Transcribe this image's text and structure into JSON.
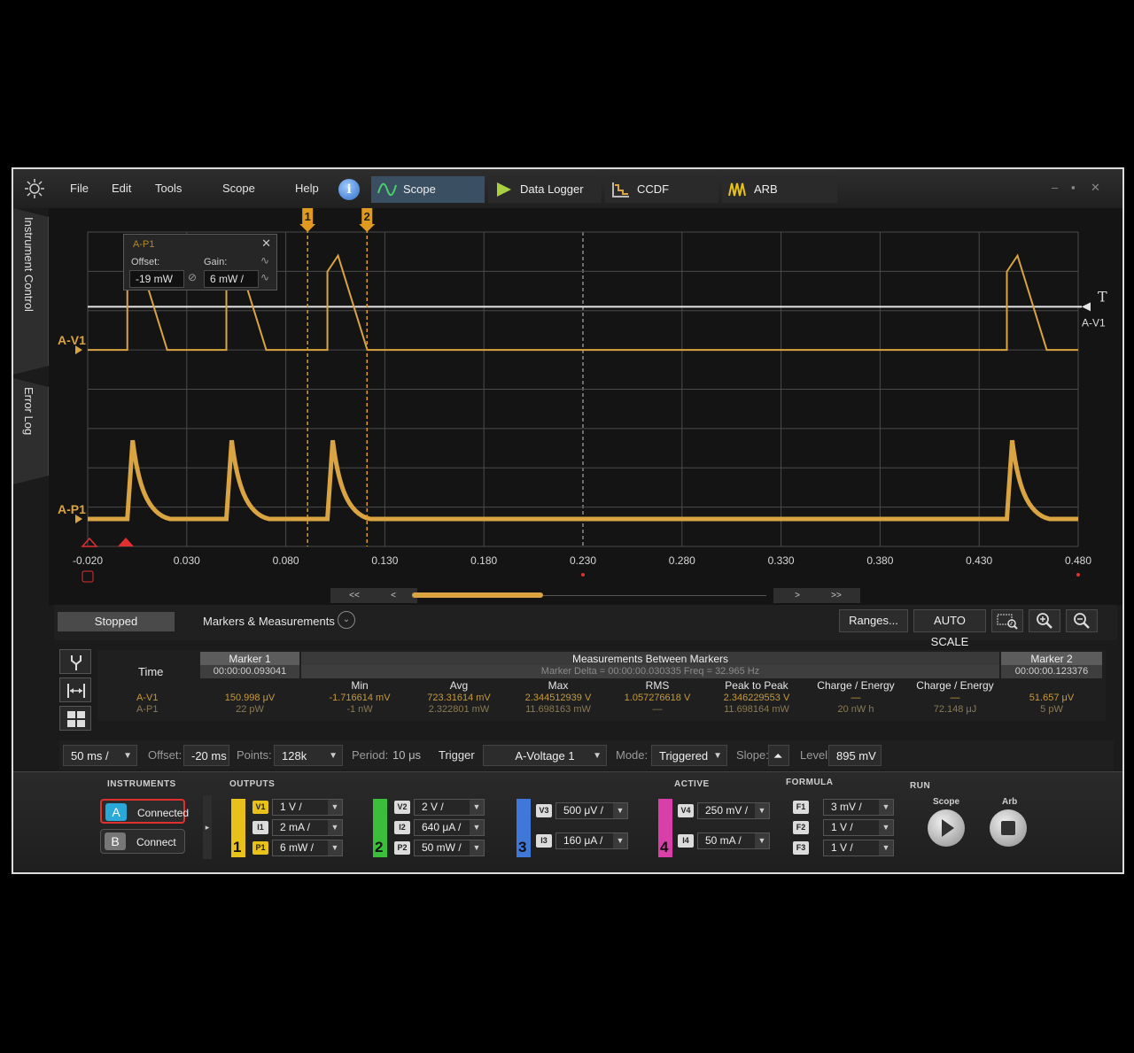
{
  "menu": {
    "file": "File",
    "edit": "Edit",
    "tools": "Tools",
    "scope": "Scope",
    "help": "Help",
    "help_icon": "i"
  },
  "app_tabs": [
    {
      "label": "Scope",
      "icon": "sine-wave-icon"
    },
    {
      "label": "Data Logger",
      "icon": "play-icon"
    },
    {
      "label": "CCDF",
      "icon": "ccdf-chart-icon"
    },
    {
      "label": "ARB",
      "icon": "arb-wave-icon"
    }
  ],
  "window_controls": {
    "minimize": "‒",
    "maximize": "▪",
    "close": "✕"
  },
  "side_tabs": {
    "instrument_control": "Instrument Control",
    "error_log": "Error Log"
  },
  "channel_popup": {
    "title": "A-P1",
    "close": "✕",
    "offset_label": "Offset:",
    "offset_value": "-19 mW",
    "gain_label": "Gain:",
    "gain_value": "6 mW /"
  },
  "markers": {
    "marker1": "1",
    "marker2": "2"
  },
  "trace_labels": {
    "v1": "A-V1",
    "p1": "A-P1",
    "trigger_right": "A-V1",
    "trigger_t": "T"
  },
  "scope_colors": {
    "trace": "#d9a441",
    "grid": "#4a4a4a",
    "center_axis": "#8a8a8a",
    "trigger_line": "#e6e6e6",
    "marker": "#e09a20"
  },
  "x_axis": {
    "ticks": [
      "-0.020",
      "0.030",
      "0.080",
      "0.130",
      "0.180",
      "0.230",
      "0.280",
      "0.330",
      "0.380",
      "0.430",
      "0.480"
    ],
    "range": [
      -0.02,
      0.48
    ]
  },
  "waveforms": {
    "pulse_starts_s": [
      0.0,
      0.05,
      0.101,
      0.444
    ],
    "v1_baseline_level": "low",
    "p1_baseline_level": "low"
  },
  "scroll": {
    "first": "<<",
    "prev": "<",
    "next": ">",
    "last": ">>",
    "thumb_start_fraction": 0.0,
    "thumb_width_fraction": 0.37
  },
  "meas_toolbar": {
    "status": "Stopped",
    "title": "Markers & Measurements",
    "expand_icon": "⌄",
    "ranges": "Ranges...",
    "auto_scale": "AUTO SCALE"
  },
  "meas_table": {
    "time_label": "Time",
    "marker1_title": "Marker 1",
    "marker1_time": "00:00:00.093041",
    "between_title": "Measurements Between Markers",
    "between_sub": "Marker Delta = 00:00:00.030335    Freq = 32.965 Hz",
    "marker2_title": "Marker 2",
    "marker2_time": "00:00:00.123376",
    "columns": [
      "Min",
      "Avg",
      "Max",
      "RMS",
      "Peak to Peak",
      "Charge / Energy",
      "Charge / Energy"
    ],
    "rows": [
      {
        "name": "A-V1",
        "marker1": "150.998 μV",
        "values": [
          "-1.716614 mV",
          "723.31614 mV",
          "2.344512939 V",
          "1.057276618 V",
          "2.346229553 V",
          "—",
          "—"
        ],
        "marker2": "51.657 μV"
      },
      {
        "name": "A-P1",
        "marker1": "22 pW",
        "values": [
          "-1 nW",
          "2.322801 mW",
          "11.698163 mW",
          "—",
          "11.698164 mW",
          "20 nW h",
          "72.148 μJ"
        ],
        "marker2": "5 pW"
      }
    ]
  },
  "h_settings": {
    "timebase": "50 ms /",
    "offset_label": "Offset:",
    "offset_value": "-20 ms",
    "points_label": "Points:",
    "points_value": "128k",
    "period_label": "Period:",
    "period_value": "10 μs",
    "trigger_label": "Trigger",
    "trigger_value": "A-Voltage 1",
    "mode_label": "Mode:",
    "mode_value": "Triggered",
    "slope_label": "Slope:",
    "level_label": "Level:",
    "level_value": "895 mV"
  },
  "control_bar": {
    "instruments_title": "INSTRUMENTS",
    "outputs_title": "OUTPUTS",
    "active_title": "ACTIVE",
    "formula_title": "FORMULA",
    "run_title": "RUN",
    "instrument_a": {
      "badge": "A",
      "label": "Connected"
    },
    "instrument_b": {
      "badge": "B",
      "label": "Connect"
    },
    "channel1": {
      "number": "1",
      "color": "#e8c21a",
      "rows": [
        {
          "tag": "V1",
          "scale": "1 V /"
        },
        {
          "tag": "I1",
          "scale": "2 mA /"
        },
        {
          "tag": "P1",
          "scale": "6 mW /"
        }
      ]
    },
    "channel2": {
      "number": "2",
      "color": "#3bbf3b",
      "rows": [
        {
          "tag": "V2",
          "scale": "2 V /"
        },
        {
          "tag": "I2",
          "scale": "640 μA /"
        },
        {
          "tag": "P2",
          "scale": "50 mW /"
        }
      ]
    },
    "channel3": {
      "number": "3",
      "color": "#3f78d8",
      "rows": [
        {
          "tag": "V3",
          "scale": "500 μV /"
        },
        {
          "tag": "I3",
          "scale": "160 μA /"
        }
      ]
    },
    "channel4": {
      "number": "4",
      "color": "#d83fa8",
      "rows": [
        {
          "tag": "V4",
          "scale": "250 mV /"
        },
        {
          "tag": "I4",
          "scale": "50 mA /"
        }
      ]
    },
    "formula": [
      {
        "tag": "F1",
        "scale": "3 mV /"
      },
      {
        "tag": "F2",
        "scale": "1 V /"
      },
      {
        "tag": "F3",
        "scale": "1 V /"
      }
    ],
    "run_scope": "Scope",
    "run_arb": "Arb"
  }
}
